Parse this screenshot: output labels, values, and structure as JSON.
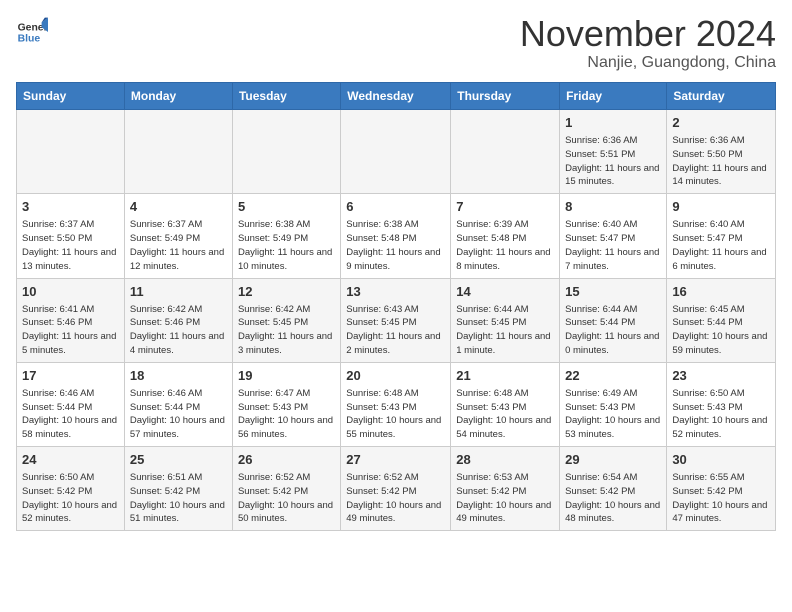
{
  "header": {
    "logo_line1": "General",
    "logo_line2": "Blue",
    "month_title": "November 2024",
    "location": "Nanjie, Guangdong, China"
  },
  "days_of_week": [
    "Sunday",
    "Monday",
    "Tuesday",
    "Wednesday",
    "Thursday",
    "Friday",
    "Saturday"
  ],
  "weeks": [
    [
      {
        "day": "",
        "info": ""
      },
      {
        "day": "",
        "info": ""
      },
      {
        "day": "",
        "info": ""
      },
      {
        "day": "",
        "info": ""
      },
      {
        "day": "",
        "info": ""
      },
      {
        "day": "1",
        "info": "Sunrise: 6:36 AM\nSunset: 5:51 PM\nDaylight: 11 hours and 15 minutes."
      },
      {
        "day": "2",
        "info": "Sunrise: 6:36 AM\nSunset: 5:50 PM\nDaylight: 11 hours and 14 minutes."
      }
    ],
    [
      {
        "day": "3",
        "info": "Sunrise: 6:37 AM\nSunset: 5:50 PM\nDaylight: 11 hours and 13 minutes."
      },
      {
        "day": "4",
        "info": "Sunrise: 6:37 AM\nSunset: 5:49 PM\nDaylight: 11 hours and 12 minutes."
      },
      {
        "day": "5",
        "info": "Sunrise: 6:38 AM\nSunset: 5:49 PM\nDaylight: 11 hours and 10 minutes."
      },
      {
        "day": "6",
        "info": "Sunrise: 6:38 AM\nSunset: 5:48 PM\nDaylight: 11 hours and 9 minutes."
      },
      {
        "day": "7",
        "info": "Sunrise: 6:39 AM\nSunset: 5:48 PM\nDaylight: 11 hours and 8 minutes."
      },
      {
        "day": "8",
        "info": "Sunrise: 6:40 AM\nSunset: 5:47 PM\nDaylight: 11 hours and 7 minutes."
      },
      {
        "day": "9",
        "info": "Sunrise: 6:40 AM\nSunset: 5:47 PM\nDaylight: 11 hours and 6 minutes."
      }
    ],
    [
      {
        "day": "10",
        "info": "Sunrise: 6:41 AM\nSunset: 5:46 PM\nDaylight: 11 hours and 5 minutes."
      },
      {
        "day": "11",
        "info": "Sunrise: 6:42 AM\nSunset: 5:46 PM\nDaylight: 11 hours and 4 minutes."
      },
      {
        "day": "12",
        "info": "Sunrise: 6:42 AM\nSunset: 5:45 PM\nDaylight: 11 hours and 3 minutes."
      },
      {
        "day": "13",
        "info": "Sunrise: 6:43 AM\nSunset: 5:45 PM\nDaylight: 11 hours and 2 minutes."
      },
      {
        "day": "14",
        "info": "Sunrise: 6:44 AM\nSunset: 5:45 PM\nDaylight: 11 hours and 1 minute."
      },
      {
        "day": "15",
        "info": "Sunrise: 6:44 AM\nSunset: 5:44 PM\nDaylight: 11 hours and 0 minutes."
      },
      {
        "day": "16",
        "info": "Sunrise: 6:45 AM\nSunset: 5:44 PM\nDaylight: 10 hours and 59 minutes."
      }
    ],
    [
      {
        "day": "17",
        "info": "Sunrise: 6:46 AM\nSunset: 5:44 PM\nDaylight: 10 hours and 58 minutes."
      },
      {
        "day": "18",
        "info": "Sunrise: 6:46 AM\nSunset: 5:44 PM\nDaylight: 10 hours and 57 minutes."
      },
      {
        "day": "19",
        "info": "Sunrise: 6:47 AM\nSunset: 5:43 PM\nDaylight: 10 hours and 56 minutes."
      },
      {
        "day": "20",
        "info": "Sunrise: 6:48 AM\nSunset: 5:43 PM\nDaylight: 10 hours and 55 minutes."
      },
      {
        "day": "21",
        "info": "Sunrise: 6:48 AM\nSunset: 5:43 PM\nDaylight: 10 hours and 54 minutes."
      },
      {
        "day": "22",
        "info": "Sunrise: 6:49 AM\nSunset: 5:43 PM\nDaylight: 10 hours and 53 minutes."
      },
      {
        "day": "23",
        "info": "Sunrise: 6:50 AM\nSunset: 5:43 PM\nDaylight: 10 hours and 52 minutes."
      }
    ],
    [
      {
        "day": "24",
        "info": "Sunrise: 6:50 AM\nSunset: 5:42 PM\nDaylight: 10 hours and 52 minutes."
      },
      {
        "day": "25",
        "info": "Sunrise: 6:51 AM\nSunset: 5:42 PM\nDaylight: 10 hours and 51 minutes."
      },
      {
        "day": "26",
        "info": "Sunrise: 6:52 AM\nSunset: 5:42 PM\nDaylight: 10 hours and 50 minutes."
      },
      {
        "day": "27",
        "info": "Sunrise: 6:52 AM\nSunset: 5:42 PM\nDaylight: 10 hours and 49 minutes."
      },
      {
        "day": "28",
        "info": "Sunrise: 6:53 AM\nSunset: 5:42 PM\nDaylight: 10 hours and 49 minutes."
      },
      {
        "day": "29",
        "info": "Sunrise: 6:54 AM\nSunset: 5:42 PM\nDaylight: 10 hours and 48 minutes."
      },
      {
        "day": "30",
        "info": "Sunrise: 6:55 AM\nSunset: 5:42 PM\nDaylight: 10 hours and 47 minutes."
      }
    ]
  ]
}
